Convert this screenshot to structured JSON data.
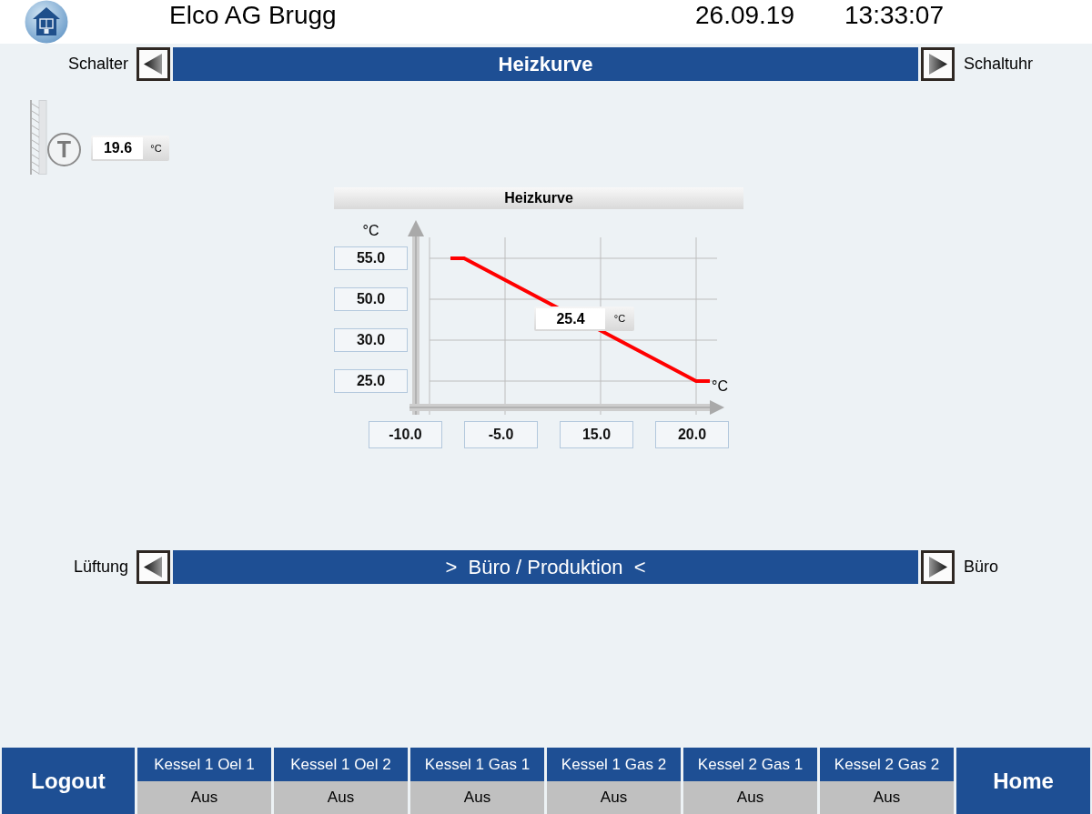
{
  "header": {
    "title": "Elco AG Brugg",
    "date": "26.09.19",
    "time": "13:33:07"
  },
  "page_nav": {
    "previous": "Schalter",
    "title": "Heizkurve",
    "next": "Schaltuhr"
  },
  "room_sensor": {
    "symbol": "T",
    "value": "19.6",
    "unit": "°C"
  },
  "heating_curve": {
    "title": "Heizkurve",
    "y_unit": "°C",
    "y_values": [
      "55.0",
      "50.0",
      "30.0",
      "25.0"
    ],
    "x_unit": "°C",
    "x_values": [
      "-10.0",
      "-5.0",
      "15.0",
      "20.0"
    ],
    "readout": {
      "value": "25.4",
      "unit": "°C"
    }
  },
  "zone_nav": {
    "previous": "Lüftung",
    "title": ">  Büro / Produktion  <",
    "next": "Büro"
  },
  "footer": {
    "logout": "Logout",
    "boilers": [
      {
        "name": "Kessel 1 Oel 1",
        "status": "Aus"
      },
      {
        "name": "Kessel 1 Oel 2",
        "status": "Aus"
      },
      {
        "name": "Kessel 1 Gas 1",
        "status": "Aus"
      },
      {
        "name": "Kessel 1 Gas 2",
        "status": "Aus"
      },
      {
        "name": "Kessel 2 Gas 1",
        "status": "Aus"
      },
      {
        "name": "Kessel 2 Gas 2",
        "status": "Aus"
      }
    ],
    "home": "Home"
  }
}
